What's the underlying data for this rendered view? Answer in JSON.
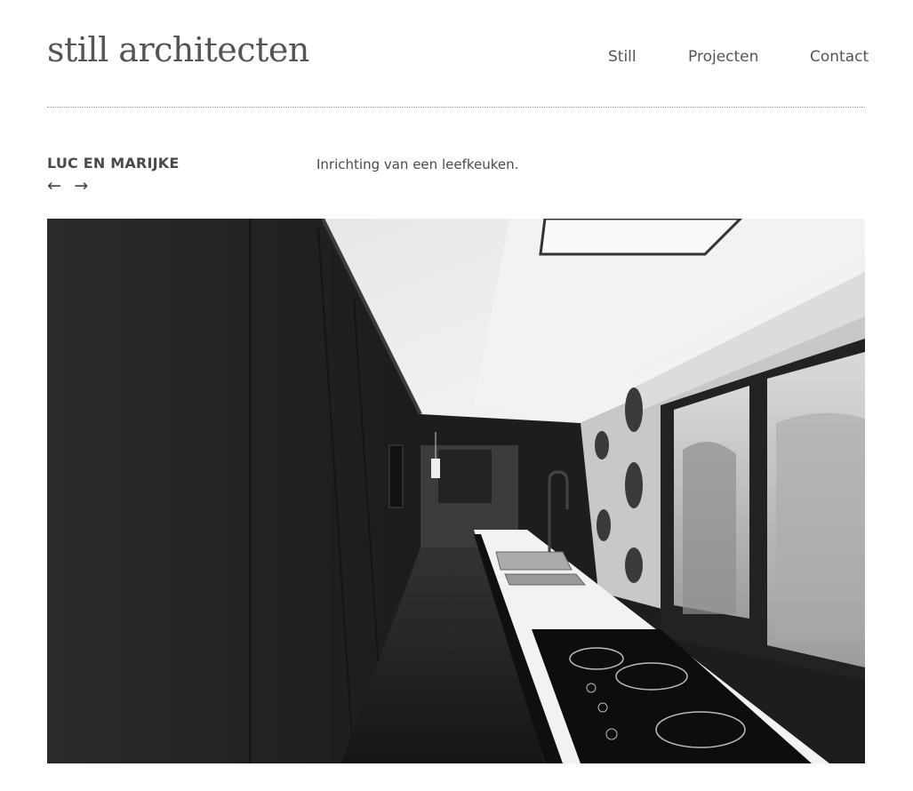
{
  "header": {
    "site_title": "still architecten",
    "nav": [
      {
        "label": "Still"
      },
      {
        "label": "Projecten"
      },
      {
        "label": "Contact"
      }
    ]
  },
  "project": {
    "title": "LUC EN MARIJKE",
    "prev_arrow": "←",
    "next_arrow": "→",
    "description": "Inrichting van een leefkeuken."
  },
  "image": {
    "subject": "black and white kitchen interior photograph"
  }
}
